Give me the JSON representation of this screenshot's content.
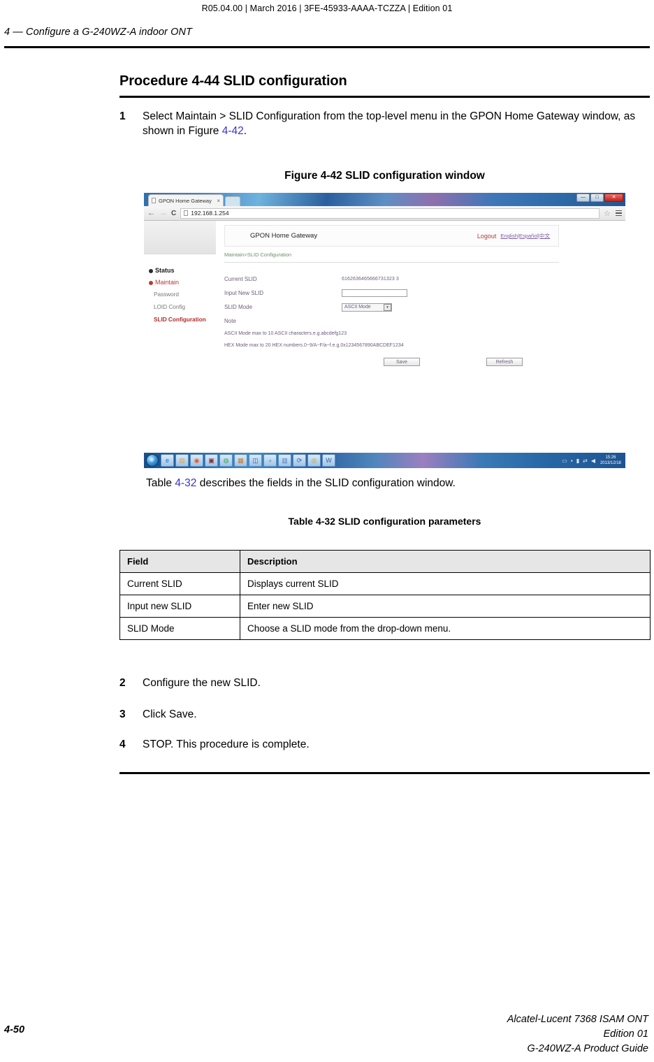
{
  "header": {
    "top_line": "R05.04.00 | March 2016 | 3FE-45933-AAAA-TCZZA | Edition 01",
    "running_head": "4 —  Configure a G-240WZ-A indoor ONT"
  },
  "procedure": {
    "title": "Procedure 4-44  SLID configuration",
    "steps": [
      {
        "num": "1",
        "text_before": "Select Maintain > SLID Configuration from the top-level menu in the GPON Home Gateway window, as shown in Figure ",
        "xref": "4-42",
        "text_after": "."
      },
      {
        "num": "2",
        "text": "Configure the new SLID."
      },
      {
        "num": "3",
        "text": "Click Save."
      },
      {
        "num": "4",
        "text": "STOP. This procedure is complete."
      }
    ]
  },
  "figure": {
    "caption": "Figure 4-42  SLID configuration window",
    "browser": {
      "tab_title": "GPON Home Gateway",
      "tab_close": "×",
      "url": "192.168.1.254",
      "back_icon": "←",
      "forward_icon": "→",
      "reload_icon": "C",
      "star_icon": "☆",
      "minimize_label": "—",
      "maximize_label": "□",
      "close_label": "✕"
    },
    "app": {
      "title": "GPON Home Gateway",
      "logout": "Logout",
      "languages": "English|Español|中文",
      "breadcrumb": "Maintain>SLID Configuration",
      "sidebar": [
        {
          "label": "Status",
          "type": "group",
          "expand": "+"
        },
        {
          "label": "Maintain",
          "type": "group",
          "expand": "−"
        },
        {
          "label": "Password",
          "type": "sub"
        },
        {
          "label": "LOID Config",
          "type": "sub"
        },
        {
          "label": "SLID Configuration",
          "type": "sub",
          "active": true
        }
      ],
      "fields": {
        "current_slid_label": "Current SLID",
        "current_slid_value": "6162636465666731323 3",
        "input_new_slid_label": "Input New SLID",
        "input_new_slid_value": "",
        "slid_mode_label": "SLID Mode",
        "slid_mode_value": "ASCII Mode",
        "dropdown_arrow": "▾"
      },
      "note": {
        "title": "Note",
        "line1": "ASCII Mode max to 10 ASCII characters.e.g.abcdefg123",
        "line2": "HEX Mode max to 20 HEX numbers.0~9/A~F/a~f.e.g.0x1234567890ABCDEF1234"
      },
      "buttons": {
        "save": "Save",
        "refresh": "Refresh"
      }
    },
    "taskbar": {
      "start_icon": "start-orb",
      "items": [
        {
          "icon": "ie-icon",
          "glyph": "e",
          "color": "#1a6bb5"
        },
        {
          "icon": "notepad-icon",
          "glyph": "▤",
          "color": "#d9a441"
        },
        {
          "icon": "firefox-icon",
          "glyph": "◉",
          "color": "#e25822"
        },
        {
          "icon": "media-icon",
          "glyph": "▣",
          "color": "#8b2a2a"
        },
        {
          "icon": "chrome-icon",
          "glyph": "◍",
          "color": "#34a853"
        },
        {
          "icon": "book-icon",
          "glyph": "▦",
          "color": "#c77b2a"
        },
        {
          "icon": "outlook-icon",
          "glyph": "◫",
          "color": "#2b5fa8"
        },
        {
          "icon": "disc-icon",
          "glyph": "◕",
          "color": "#7fa8d4"
        },
        {
          "icon": "printer-icon",
          "glyph": "▥",
          "color": "#4a7fbd"
        },
        {
          "icon": "sync-icon",
          "glyph": "⟳",
          "color": "#2b5fa8"
        },
        {
          "icon": "shield-icon",
          "glyph": "◎",
          "color": "#b8a020"
        },
        {
          "icon": "word-icon",
          "glyph": "W",
          "color": "#2b5fa8"
        }
      ],
      "tray": [
        "▭",
        "▪",
        "🔋",
        "⇄",
        "🔊"
      ],
      "clock_time": "15:26",
      "clock_date": "2013/12/18"
    }
  },
  "table_intro": {
    "prefix": "Table ",
    "xref": "4-32",
    "suffix": " describes the fields in the SLID configuration window."
  },
  "table": {
    "caption": "Table 4-32 SLID configuration parameters",
    "columns": [
      "Field",
      "Description"
    ],
    "rows": [
      [
        "Current SLID",
        "Displays current SLID"
      ],
      [
        "Input new SLID",
        "Enter new SLID"
      ],
      [
        "SLID Mode",
        "Choose a SLID mode from the drop-down menu."
      ]
    ]
  },
  "footer": {
    "page_number": "4-50",
    "line1": "Alcatel-Lucent 7368 ISAM ONT",
    "line2": "Edition 01",
    "line3": "G-240WZ-A Product Guide"
  }
}
